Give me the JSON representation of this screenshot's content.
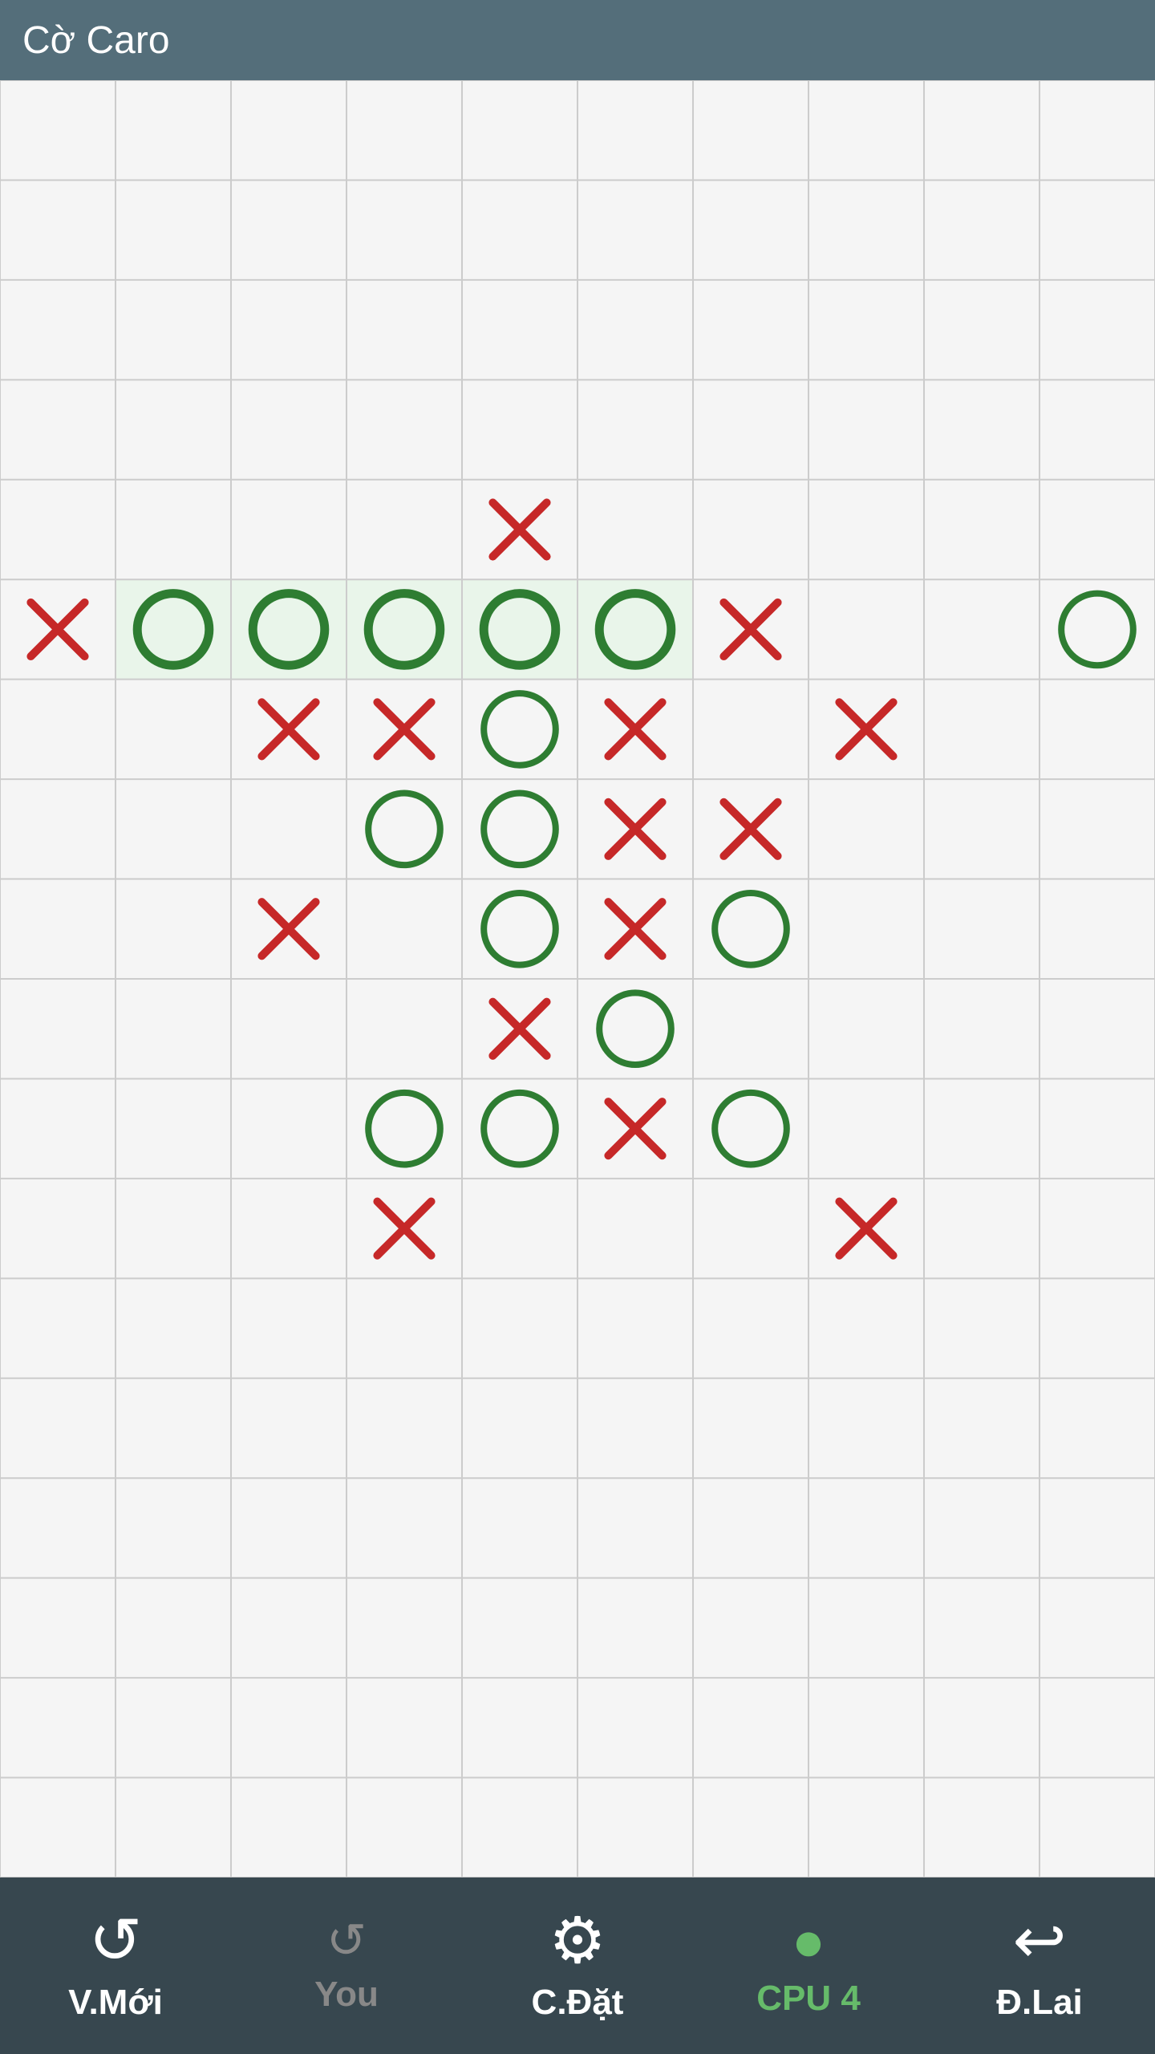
{
  "app": {
    "title": "Cờ Caro"
  },
  "toolbar": {
    "new_game_label": "V.Mới",
    "you_label": "You",
    "settings_label": "C.Đặt",
    "cpu_label": "CPU 4",
    "undo_label": "Đ.Lai"
  },
  "board": {
    "cols": 10,
    "rows": 18,
    "cell_size": 144,
    "highlight_row": 5,
    "highlight_cols": [
      1,
      2,
      3,
      4,
      5
    ],
    "pieces": [
      {
        "row": 4,
        "col": 4,
        "type": "X"
      },
      {
        "row": 5,
        "col": 0,
        "type": "X"
      },
      {
        "row": 5,
        "col": 1,
        "type": "O",
        "highlight": true
      },
      {
        "row": 5,
        "col": 2,
        "type": "O",
        "highlight": true
      },
      {
        "row": 5,
        "col": 3,
        "type": "O",
        "highlight": true
      },
      {
        "row": 5,
        "col": 4,
        "type": "O",
        "highlight": true
      },
      {
        "row": 5,
        "col": 5,
        "type": "O",
        "highlight": true
      },
      {
        "row": 5,
        "col": 6,
        "type": "X"
      },
      {
        "row": 5,
        "col": 9,
        "type": "O"
      },
      {
        "row": 6,
        "col": 2,
        "type": "X"
      },
      {
        "row": 6,
        "col": 3,
        "type": "X"
      },
      {
        "row": 6,
        "col": 4,
        "type": "O"
      },
      {
        "row": 6,
        "col": 5,
        "type": "X"
      },
      {
        "row": 6,
        "col": 7,
        "type": "X"
      },
      {
        "row": 7,
        "col": 3,
        "type": "O"
      },
      {
        "row": 7,
        "col": 4,
        "type": "O"
      },
      {
        "row": 7,
        "col": 5,
        "type": "X"
      },
      {
        "row": 7,
        "col": 6,
        "type": "X"
      },
      {
        "row": 8,
        "col": 2,
        "type": "X"
      },
      {
        "row": 8,
        "col": 4,
        "type": "O"
      },
      {
        "row": 8,
        "col": 5,
        "type": "X"
      },
      {
        "row": 8,
        "col": 6,
        "type": "O"
      },
      {
        "row": 9,
        "col": 4,
        "type": "X"
      },
      {
        "row": 9,
        "col": 5,
        "type": "O"
      },
      {
        "row": 10,
        "col": 3,
        "type": "O"
      },
      {
        "row": 10,
        "col": 4,
        "type": "O"
      },
      {
        "row": 10,
        "col": 5,
        "type": "X"
      },
      {
        "row": 10,
        "col": 6,
        "type": "O"
      },
      {
        "row": 11,
        "col": 3,
        "type": "X"
      },
      {
        "row": 11,
        "col": 7,
        "type": "X"
      }
    ]
  }
}
